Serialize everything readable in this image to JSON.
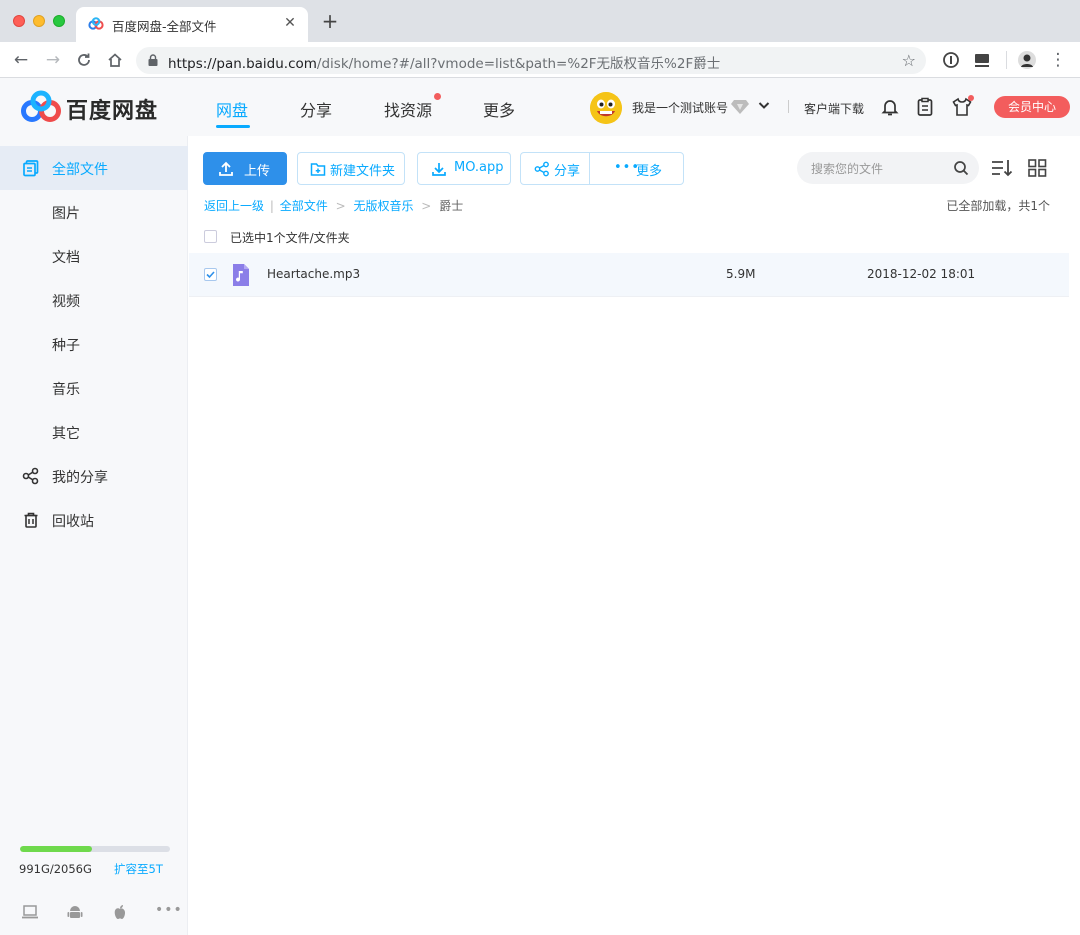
{
  "browser": {
    "tab_title": "百度网盘-全部文件",
    "url_host": "https://pan.baidu.com",
    "url_path": "/disk/home?#/all?vmode=list&path=%2F无版权音乐%2F爵士"
  },
  "header": {
    "logo_text": "百度网盘",
    "nav": [
      {
        "label": "网盘",
        "active": true
      },
      {
        "label": "分享"
      },
      {
        "label": "找资源",
        "badge_dot": true
      },
      {
        "label": "更多"
      }
    ],
    "username": "我是一个测试账号",
    "client_download": "客户端下载",
    "vip_center": "会员中心"
  },
  "sidebar": {
    "items": [
      {
        "label": "全部文件",
        "active": true,
        "icon": "files-icon"
      },
      {
        "label": "图片"
      },
      {
        "label": "文档"
      },
      {
        "label": "视频"
      },
      {
        "label": "种子"
      },
      {
        "label": "音乐"
      },
      {
        "label": "其它"
      },
      {
        "label": "我的分享",
        "icon": "share-icon"
      },
      {
        "label": "回收站",
        "icon": "trash-icon"
      }
    ],
    "quota": {
      "used_text": "991G/2056G",
      "used_fraction": 0.482,
      "expand_label": "扩容至5T"
    }
  },
  "toolbar": {
    "upload": "上传",
    "new_folder": "新建文件夹",
    "download": "MO.app",
    "share": "分享",
    "more": "更多",
    "search_placeholder": "搜索您的文件"
  },
  "breadcrumb": {
    "back": "返回上一级",
    "sep1": "|",
    "items": [
      "全部文件",
      "无版权音乐",
      "爵士"
    ],
    "arrow": ">"
  },
  "loaded_text": "已全部加载，共1个",
  "selection_text": "已选中1个文件/文件夹",
  "files": [
    {
      "name": "Heartache.mp3",
      "size": "5.9M",
      "modified": "2018-12-02 18:01",
      "checked": true
    }
  ],
  "colors": {
    "accent": "#09aaff",
    "primary_button": "#2e90ea",
    "vip": "#f35d5d",
    "quota_fill": "#6fd94c"
  }
}
